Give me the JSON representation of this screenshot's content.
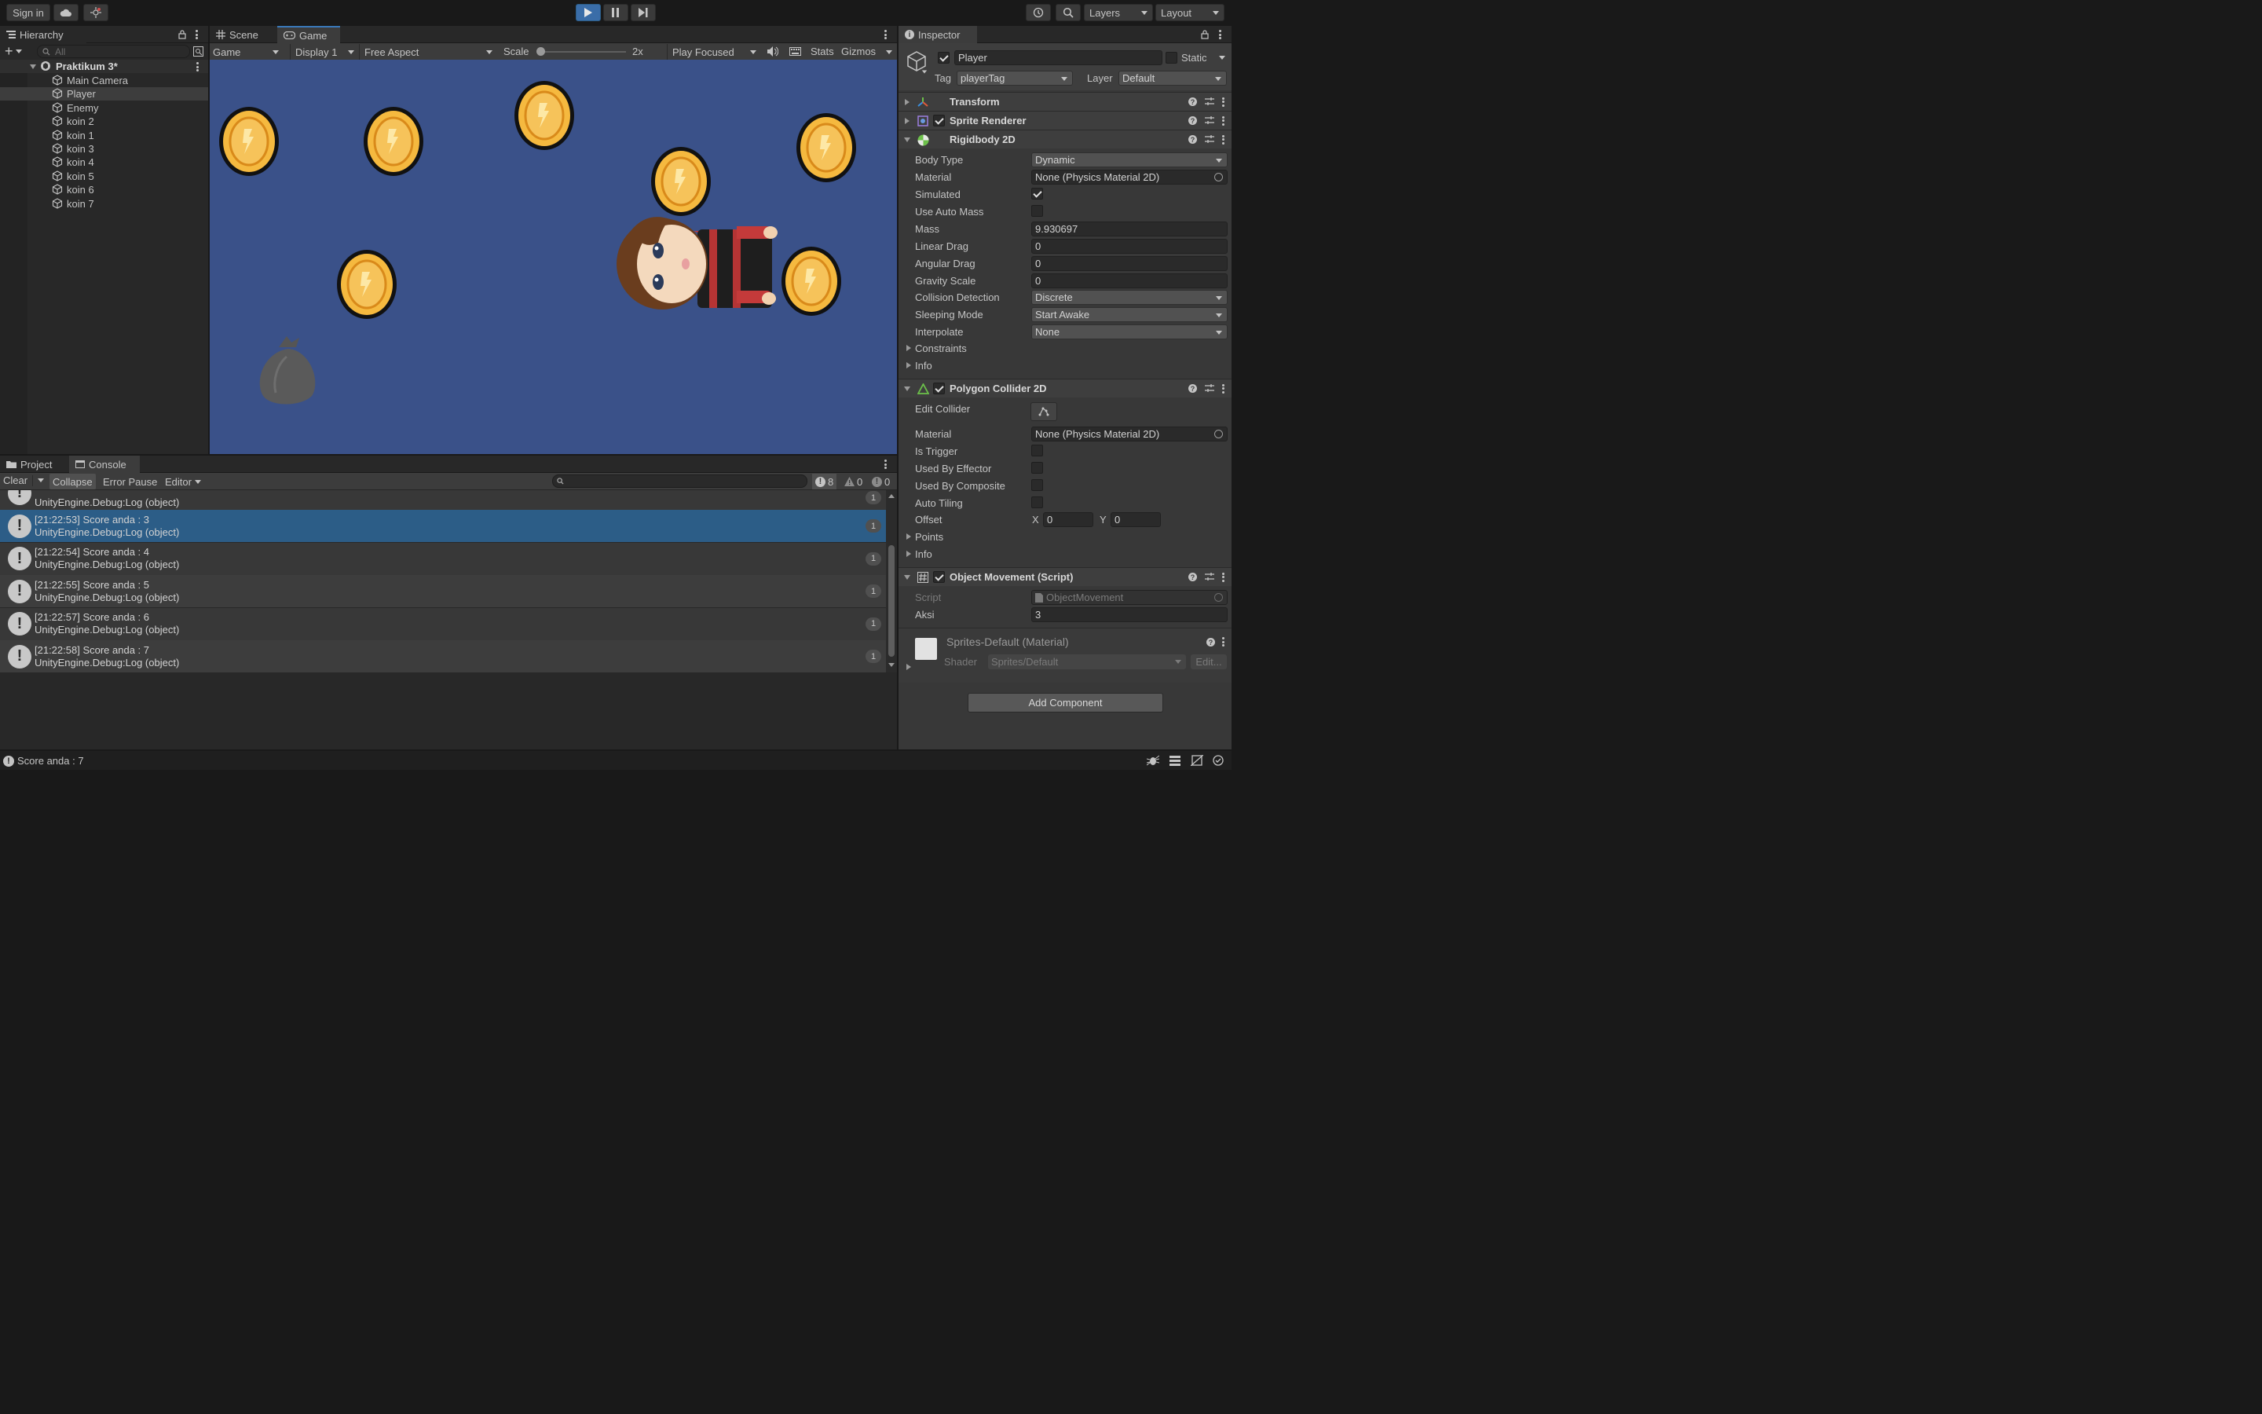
{
  "toolbar": {
    "sign_in": "Sign in",
    "layers": "Layers",
    "layout": "Layout"
  },
  "hierarchy": {
    "tab": "Hierarchy",
    "search_placeholder": "All",
    "scene_name": "Praktikum 3*",
    "items": [
      {
        "label": "Main Camera"
      },
      {
        "label": "Player"
      },
      {
        "label": "Enemy"
      },
      {
        "label": "koin 2"
      },
      {
        "label": "koin 1"
      },
      {
        "label": "koin 3"
      },
      {
        "label": "koin 4"
      },
      {
        "label": "koin 5"
      },
      {
        "label": "koin 6"
      },
      {
        "label": "koin 7"
      }
    ]
  },
  "game": {
    "tabs": {
      "scene": "Scene",
      "game": "Game"
    },
    "view_mode": "Game",
    "display": "Display 1",
    "aspect": "Free Aspect",
    "scale_label": "Scale",
    "scale_value": "2x",
    "play_mode": "Play Focused",
    "stats": "Stats",
    "gizmos": "Gizmos"
  },
  "console": {
    "tabs": {
      "project": "Project",
      "console": "Console"
    },
    "clear": "Clear",
    "collapse": "Collapse",
    "error_pause": "Error Pause",
    "editor": "Editor",
    "counts": {
      "log": "8",
      "warn": "0",
      "error": "0"
    },
    "partial_line": "UnityEngine.Debug:Log (object)",
    "partial_count": "1",
    "entries": [
      {
        "line1": "[21:22:53] Score anda : 3",
        "line2": "UnityEngine.Debug:Log (object)",
        "count": "1"
      },
      {
        "line1": "[21:22:54] Score anda : 4",
        "line2": "UnityEngine.Debug:Log (object)",
        "count": "1"
      },
      {
        "line1": "[21:22:55] Score anda : 5",
        "line2": "UnityEngine.Debug:Log (object)",
        "count": "1"
      },
      {
        "line1": "[21:22:57] Score anda : 6",
        "line2": "UnityEngine.Debug:Log (object)",
        "count": "1"
      },
      {
        "line1": "[21:22:58] Score anda : 7",
        "line2": "UnityEngine.Debug:Log (object)",
        "count": "1"
      }
    ]
  },
  "inspector": {
    "tab": "Inspector",
    "object_name": "Player",
    "static_label": "Static",
    "tag_label": "Tag",
    "tag_value": "playerTag",
    "layer_label": "Layer",
    "layer_value": "Default",
    "transform": "Transform",
    "sprite_renderer": "Sprite Renderer",
    "rigidbody": {
      "title": "Rigidbody 2D",
      "body_type_label": "Body Type",
      "body_type": "Dynamic",
      "material_label": "Material",
      "material": "None (Physics Material 2D)",
      "simulated_label": "Simulated",
      "auto_mass_label": "Use Auto Mass",
      "mass_label": "Mass",
      "mass": "9.930697",
      "linear_drag_label": "Linear Drag",
      "linear_drag": "0",
      "angular_drag_label": "Angular Drag",
      "angular_drag": "0",
      "gravity_label": "Gravity Scale",
      "gravity": "0",
      "collision_label": "Collision Detection",
      "collision": "Discrete",
      "sleeping_label": "Sleeping Mode",
      "sleeping": "Start Awake",
      "interpolate_label": "Interpolate",
      "interpolate": "None",
      "constraints": "Constraints",
      "info": "Info"
    },
    "polygon": {
      "title": "Polygon Collider 2D",
      "edit_label": "Edit Collider",
      "material_label": "Material",
      "material": "None (Physics Material 2D)",
      "trigger_label": "Is Trigger",
      "effector_label": "Used By Effector",
      "composite_label": "Used By Composite",
      "autotiling_label": "Auto Tiling",
      "offset_label": "Offset",
      "x_label": "X",
      "x": "0",
      "y_label": "Y",
      "y": "0",
      "points": "Points",
      "info": "Info"
    },
    "script": {
      "title": "Object Movement (Script)",
      "script_label": "Script",
      "script_value": "ObjectMovement",
      "aksi_label": "Aksi",
      "aksi": "3"
    },
    "material": {
      "title": "Sprites-Default (Material)",
      "shader_label": "Shader",
      "shader": "Sprites/Default",
      "edit": "Edit..."
    },
    "add_component": "Add Component"
  },
  "status": {
    "message": "Score anda : 7"
  },
  "colors": {
    "accent": "#3a79bb",
    "game_bg": "#3a5189",
    "selection": "#2c5d87"
  }
}
